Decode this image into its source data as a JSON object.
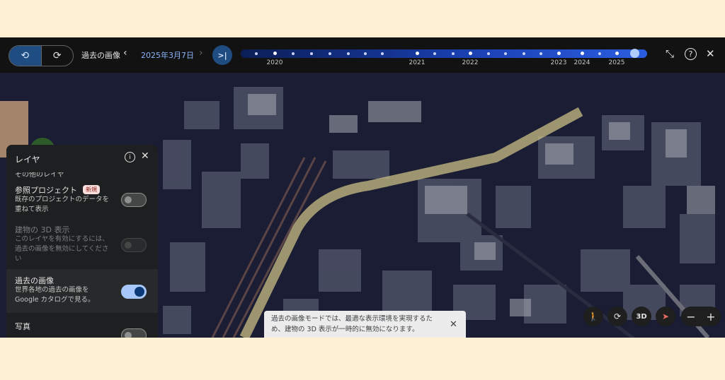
{
  "topbar": {
    "mode_buttons": [
      {
        "icon": "history-rewind-icon",
        "glyph": "⟲",
        "active": true
      },
      {
        "icon": "refresh-forward-icon",
        "glyph": "⟳",
        "active": false
      }
    ],
    "historical_label": "過去の画像",
    "prev_glyph": "‹",
    "date_label": "2025年3月7日",
    "next_glyph": "›",
    "skip_end_glyph": ">|",
    "timeline": {
      "years": [
        "2020",
        "2021",
        "2022",
        "2023",
        "2024",
        "2025"
      ],
      "selected_date": "2025年3月7日"
    },
    "collapse_glyph": "⤡",
    "help_glyph": "?",
    "close_glyph": "✕"
  },
  "layers_panel": {
    "title": "レイヤ",
    "info_glyph": "i",
    "close_glyph": "✕",
    "other_layers_label": "その他のレイヤ",
    "rows": [
      {
        "title": "参照プロジェクト",
        "badge": "新規",
        "desc": "既存のプロジェクトのデータを重ねて表示",
        "state": "off"
      },
      {
        "title": "建物の 3D 表示",
        "desc": "このレイヤを有効にするには、過去の画像を無効にしてください",
        "state": "disabled"
      },
      {
        "title": "過去の画像",
        "desc": "世界各地の過去の画像を Google カタログで見る。",
        "state": "on"
      },
      {
        "title": "写真",
        "state": "off"
      }
    ]
  },
  "toast": {
    "message": "過去の画像モードでは、最適な表示環境を実現するため、建物の 3D 表示が一時的に無効になります。",
    "close_glyph": "✕"
  },
  "map_controls": {
    "pegman_glyph": "🚶",
    "rotate_glyph": "⟳",
    "view_3d_label": "3D",
    "compass_glyph": "➤",
    "zoom_out": "−",
    "zoom_in": "+"
  },
  "colors": {
    "accent": "#1f4d82",
    "timeline_blue": "#1a3fb0",
    "toggle_on": "#a8c7fa",
    "badge": "#f9dedc",
    "background": "#fdf0d3"
  }
}
